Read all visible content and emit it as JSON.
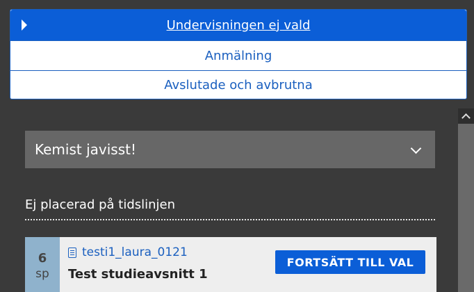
{
  "tabs": [
    {
      "label": "Undervisningen ej vald"
    },
    {
      "label": "Anmälning"
    },
    {
      "label": "Avslutade och avbrutna"
    }
  ],
  "select": {
    "value": "Kemist javisst!"
  },
  "section": {
    "title": "Ej placerad på tidslinjen"
  },
  "course": {
    "credits": "6",
    "credits_unit": "sp",
    "code": "testi1_laura_0121",
    "name": "Test studieavsnitt 1",
    "action": "FORTSÄTT TILL VAL"
  },
  "colors": {
    "accent": "#0b5ed7",
    "background": "#3a3a3a",
    "credit_bg": "#8fb2cc"
  }
}
